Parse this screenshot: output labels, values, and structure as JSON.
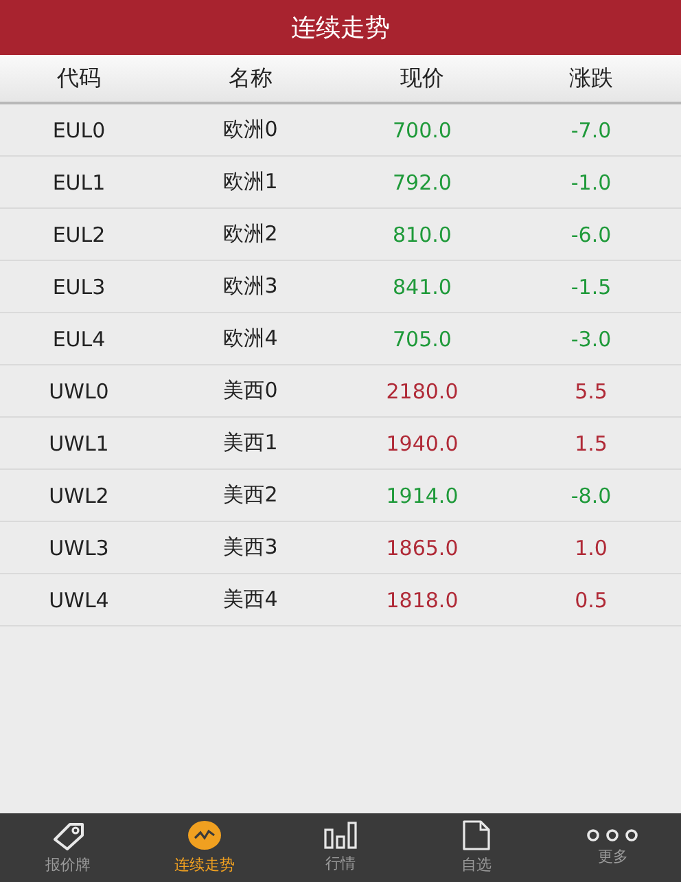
{
  "title": "连续走势",
  "columns": [
    "代码",
    "名称",
    "现价",
    "涨跌"
  ],
  "rows": [
    {
      "code": "EUL0",
      "name": "欧洲0",
      "price": "700.0",
      "change": "-7.0",
      "up": false
    },
    {
      "code": "EUL1",
      "name": "欧洲1",
      "price": "792.0",
      "change": "-1.0",
      "up": false
    },
    {
      "code": "EUL2",
      "name": "欧洲2",
      "price": "810.0",
      "change": "-6.0",
      "up": false
    },
    {
      "code": "EUL3",
      "name": "欧洲3",
      "price": "841.0",
      "change": "-1.5",
      "up": false
    },
    {
      "code": "EUL4",
      "name": "欧洲4",
      "price": "705.0",
      "change": "-3.0",
      "up": false
    },
    {
      "code": "UWL0",
      "name": "美西0",
      "price": "2180.0",
      "change": "5.5",
      "up": true
    },
    {
      "code": "UWL1",
      "name": "美西1",
      "price": "1940.0",
      "change": "1.5",
      "up": true
    },
    {
      "code": "UWL2",
      "name": "美西2",
      "price": "1914.0",
      "change": "-8.0",
      "up": false
    },
    {
      "code": "UWL3",
      "name": "美西3",
      "price": "1865.0",
      "change": "1.0",
      "up": true
    },
    {
      "code": "UWL4",
      "name": "美西4",
      "price": "1818.0",
      "change": "0.5",
      "up": true
    }
  ],
  "tabs": [
    {
      "label": "报价牌",
      "kind": "tag",
      "selected": false
    },
    {
      "label": "连续走势",
      "kind": "trend",
      "selected": true
    },
    {
      "label": "行情",
      "kind": "bars",
      "selected": false
    },
    {
      "label": "自选",
      "kind": "page",
      "selected": false
    },
    {
      "label": "更多",
      "kind": "more",
      "selected": false
    }
  ]
}
